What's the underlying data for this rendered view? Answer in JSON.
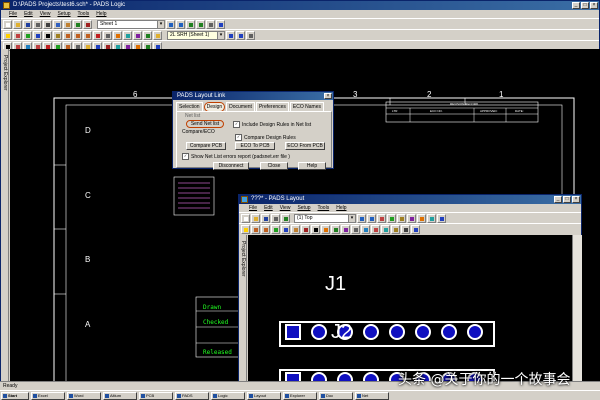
{
  "logic": {
    "title": "D:\\PADS Projects\\test6.sch* - PADS Logic",
    "menus": [
      "File",
      "Edit",
      "View",
      "Setup",
      "Tools",
      "Help"
    ],
    "sheet_combo": "Sheet 1",
    "sheet_combo2": "2L SRH (Sheet 1)",
    "sidebar_label": "Project Explorer",
    "border_cols": [
      "6",
      "3",
      "2",
      "1"
    ],
    "border_rows": [
      "D",
      "C",
      "B",
      "A"
    ],
    "revision_header": "REVISION RECORD",
    "revision_cols": [
      "LTR",
      "ECO NO.",
      "APPROVED:",
      "DATE:"
    ],
    "title_block": [
      "Drawn",
      "Checked",
      "Released"
    ]
  },
  "dialog": {
    "title": "PADS Layout Link",
    "tabs": [
      "Selection",
      "Design",
      "Document",
      "Preferences",
      "ECO Names"
    ],
    "active_tab": "Design",
    "section_netlist": "Net list",
    "send_netlist_button": "Send Net list",
    "include_rules_label": "Include Design Rules in Net list",
    "section_compare": "Compare/ECO",
    "compare_rules_label": "Compare Design Rules",
    "compare_pcb_button": "Compare PCB",
    "eco_to_pcb_button": "ECO To PCB",
    "eco_from_pcb_button": "ECO From PCB",
    "show_errors_label": "Show Net List errors report (padsnet.err file )",
    "disconnect_button": "Disconnect",
    "close_button": "Close",
    "help_button": "Help"
  },
  "layout": {
    "title": "???* - PADS Layout",
    "menus": [
      "File",
      "Edit",
      "View",
      "Setup",
      "Tools",
      "Help"
    ],
    "layer_combo": "(1) Top",
    "sidebar_label": "Project Explorer",
    "ref_j1": "J1",
    "ref_j2": "J2",
    "pad_count": 8
  },
  "statusbar_text": "Ready",
  "taskbar": {
    "start": "Start",
    "items": [
      "Excel",
      "Word",
      "Altium",
      "PCB",
      "PADS",
      "Logic",
      "Layout",
      "Explorer",
      "Doc",
      "Net"
    ]
  },
  "watermark": "头条 @关于你的一个故事会",
  "colors": {
    "titlebar": "#0a246a",
    "canvas": "#000000",
    "border_lines": "#ffffff",
    "pad_fill": "#1010c0",
    "pad_outline": "#ffffff"
  }
}
